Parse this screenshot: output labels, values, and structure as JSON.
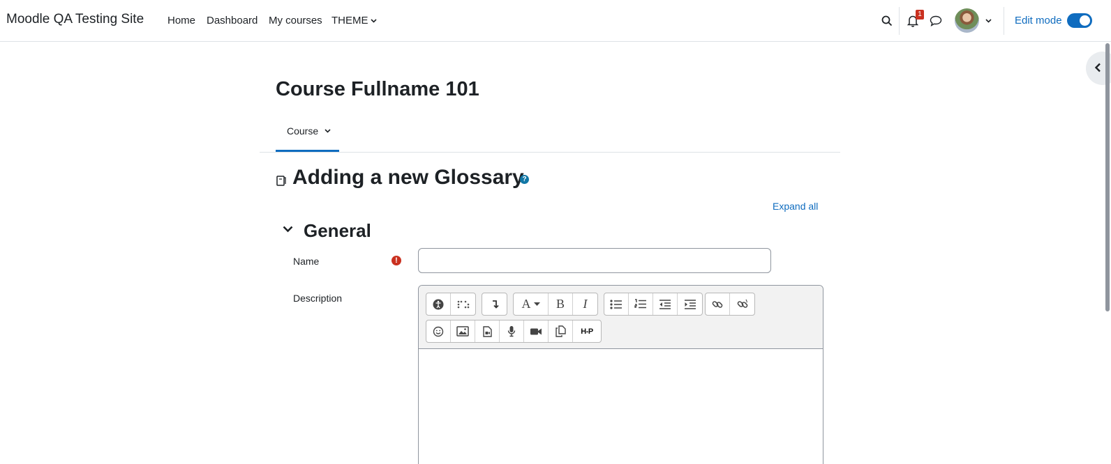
{
  "navbar": {
    "brand": "Moodle QA Testing Site",
    "links": [
      "Home",
      "Dashboard",
      "My courses",
      "THEME"
    ],
    "notification_count": "1",
    "edit_mode_label": "Edit mode"
  },
  "course": {
    "title": "Course Fullname 101",
    "tab_label": "Course"
  },
  "page": {
    "heading": "Adding a new Glossary",
    "help_symbol": "?",
    "expand_all": "Expand all"
  },
  "form": {
    "section_title": "General",
    "name_label": "Name",
    "name_value": "",
    "required_symbol": "!",
    "description_label": "Description"
  },
  "editor": {
    "row1_icons": [
      "accessibility-checker-icon",
      "screenreader-helper-icon",
      "show-more-icon",
      "font-style-icon",
      "bold-icon",
      "italic-icon",
      "unordered-list-icon",
      "ordered-list-icon",
      "outdent-icon",
      "indent-icon",
      "link-icon",
      "unlink-icon"
    ],
    "row2_icons": [
      "emoji-icon",
      "image-icon",
      "media-icon",
      "record-audio-icon",
      "record-video-icon",
      "manage-files-icon",
      "h5p-icon"
    ],
    "font_button_label": "A",
    "bold_label": "B",
    "italic_label": "I",
    "h5p_label": "H-P"
  },
  "colors": {
    "primary": "#0f6cbf",
    "danger": "#ca3120",
    "text": "#1d2125"
  }
}
